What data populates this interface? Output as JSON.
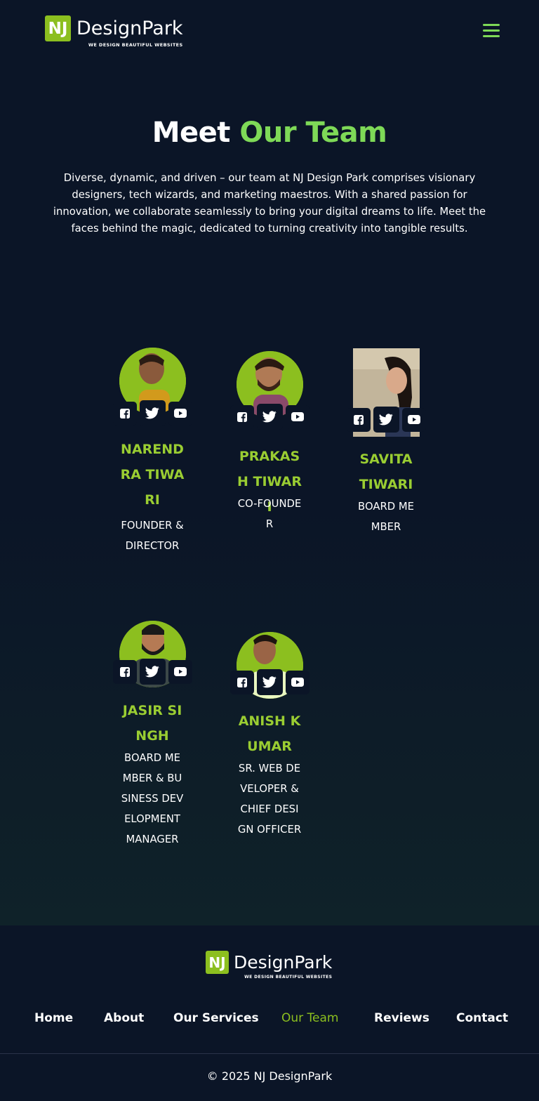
{
  "brand": {
    "mark": "NJ",
    "name": "DesignPark",
    "tagline": "WE DESIGN BEAUTIFUL WEBSITES",
    "accent_color": "#7ed957",
    "name_color": "#9acd32",
    "background": "#0b1527"
  },
  "header": {
    "menu_icon": "hamburger-menu-icon"
  },
  "hero": {
    "title_lead": "Meet ",
    "title_accent": "Our Team",
    "description": "Diverse, dynamic, and driven – our team at NJ Design Park comprises visionary designers, tech wizards, and marketing maestros. With a shared passion for innovation, we collaborate seamlessly to bring your digital dreams to life. Meet the faces behind the magic, dedicated to turning creativity into tangible results."
  },
  "team": [
    {
      "name": "NARENDRA TIWARI",
      "role": "FOUNDER & DIRECTOR",
      "socials": [
        "facebook-icon",
        "twitter-icon",
        "youtube-icon"
      ]
    },
    {
      "name": "PRAKASH TIWARI",
      "role": "CO-FOUNDER",
      "socials": [
        "facebook-icon",
        "twitter-icon",
        "youtube-icon"
      ]
    },
    {
      "name": "SAVITA TIWARI",
      "role": "BOARD MEMBER",
      "socials": [
        "facebook-icon",
        "twitter-icon",
        "youtube-icon"
      ]
    },
    {
      "name": "JASIR SINGH",
      "role": "BOARD MEMBER & BUSINESS DEVELOPMENT MANAGER",
      "socials": [
        "facebook-icon",
        "twitter-icon",
        "youtube-icon"
      ]
    },
    {
      "name": "ANISH KUMAR",
      "role": "SR. WEB DEVELOPER & CHIEF DESIGN OFFICER",
      "socials": [
        "facebook-icon",
        "twitter-icon",
        "youtube-icon"
      ]
    }
  ],
  "footer": {
    "nav": [
      {
        "label": "Home",
        "active": false
      },
      {
        "label": "About",
        "active": false
      },
      {
        "label": "Our Services",
        "active": false
      },
      {
        "label": "Our Team",
        "active": true
      },
      {
        "label": "Reviews",
        "active": false
      },
      {
        "label": "Contact",
        "active": false
      }
    ],
    "copyright": "© 2025 NJ DesignPark"
  }
}
